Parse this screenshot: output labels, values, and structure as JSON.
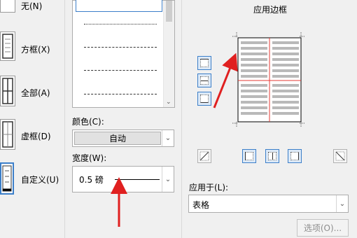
{
  "setting": {
    "items": [
      {
        "label": "无(N)"
      },
      {
        "label": "方框(X)"
      },
      {
        "label": "全部(A)"
      },
      {
        "label": "虚框(D)"
      },
      {
        "label": "自定义(U)"
      }
    ],
    "selected_index": 4
  },
  "style": {
    "lines": [
      "solid",
      "dotted",
      "dashed-fine",
      "dashed",
      "dash-dot"
    ]
  },
  "color": {
    "label": "颜色(C):",
    "value": "自动"
  },
  "width": {
    "label": "宽度(W):",
    "value": "0.5 磅"
  },
  "preview": {
    "title": "应用边框"
  },
  "apply_to": {
    "label": "应用于(L):",
    "value": "表格"
  },
  "options_button": {
    "label": "选项(O)..."
  },
  "colors": {
    "accent": "#3c7fc9",
    "arrow": "#e02020",
    "table_red_line": "#e53935"
  }
}
